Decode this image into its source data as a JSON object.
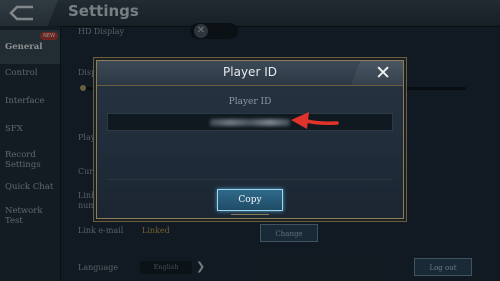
{
  "header": {
    "title": "Settings"
  },
  "sidebar": {
    "items": [
      {
        "label": "General",
        "badge": "NEW"
      },
      {
        "label": "Control"
      },
      {
        "label": "Interface"
      },
      {
        "label": "SFX"
      },
      {
        "label": "Record Settings"
      },
      {
        "label": "Quick Chat"
      },
      {
        "label": "Network Test"
      }
    ]
  },
  "background": {
    "hd_display": "HD Display",
    "disp_partial": "Disp",
    "play_partial": "Play",
    "curr_partial": "Curr",
    "link_partial": "Link",
    "num_partial": "num",
    "link_email": "Link e-mail",
    "linked": "Linked",
    "change": "Change",
    "language": "Language",
    "language_value": "English",
    "logout": "Log out"
  },
  "modal": {
    "title": "Player ID",
    "label": "Player ID",
    "copy": "Copy"
  },
  "colors": {
    "accent_arrow": "#e0342a",
    "frame_gold": "#8d7c55",
    "copy_glow": "#4aa6d0"
  },
  "icons": {
    "back": "back-arrow-icon",
    "close": "close-icon",
    "toggle": "x-icon",
    "language_next": "chevron-right-icon"
  }
}
